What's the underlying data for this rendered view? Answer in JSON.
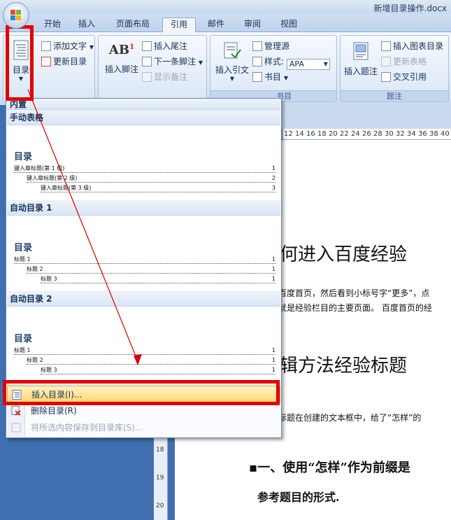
{
  "window": {
    "title": "新增目录操作.docx"
  },
  "tabs": [
    "开始",
    "插入",
    "页面布局",
    "引用",
    "邮件",
    "审阅",
    "视图"
  ],
  "active_tab": "引用",
  "ribbon": {
    "toc_group": {
      "big_button": "目录",
      "add_text": "添加文字",
      "update_toc": "更新目录"
    },
    "footnote_group": {
      "big_button": "插入脚注",
      "insert_endnote": "插入尾注",
      "next_footnote": "下一条脚注",
      "show_notes": "显示备注"
    },
    "citation_group": {
      "big_button": "插入引文",
      "manage_sources": "管理源",
      "style_label": "样式:",
      "style_value": "APA",
      "bibliography": "书目",
      "group_label_partial": "书目"
    },
    "caption_group": {
      "big_button": "插入题注",
      "insert_table_of_figures": "插入图表目录",
      "update_table": "更新表格",
      "cross_reference": "交叉引用",
      "group_label": "题注"
    }
  },
  "dropdown": {
    "header_partial": "内置",
    "sections": [
      {
        "title": "手动表格",
        "toc_heading": "目录",
        "lines": [
          {
            "text": "键入章标题(第 1 级)",
            "page": "1"
          },
          {
            "text": "键入章标题(第 2 级)",
            "page": "2"
          },
          {
            "text": "键入章标题(第 3 级)",
            "page": "3"
          }
        ]
      },
      {
        "title": "自动目录 1",
        "toc_heading": "目录",
        "lines": [
          {
            "text": "标题 1",
            "page": "1"
          },
          {
            "text": "标题 2",
            "page": "1"
          },
          {
            "text": "标题 3",
            "page": "1"
          }
        ]
      },
      {
        "title": "自动目录 2",
        "toc_heading": "目录",
        "lines": [
          {
            "text": "标题 1",
            "page": "1"
          },
          {
            "text": "标题 2",
            "page": "1"
          },
          {
            "text": "标题 3",
            "page": "1"
          }
        ]
      }
    ],
    "menu": {
      "insert_toc": "插入目录(I)...",
      "delete_toc": "删除目录(R)",
      "save_selection": "将所选内容保存到目录库(S)..."
    }
  },
  "document": {
    "ruler_numbers": [
      "12",
      "14",
      "16",
      "18",
      "20",
      "22",
      "24",
      "26",
      "28",
      "30",
      "32",
      "34",
      "36",
      "38",
      "40"
    ],
    "left_ruler_numbers": [
      "18",
      "19",
      "20"
    ],
    "heading1": "何进入百度经验",
    "para1_line1": "百度首页，然后看到小标号字“更多”，点",
    "para1_line2": "就是经验栏目的主要页面。 百度首页的经",
    "heading2": "辑方法经验标题",
    "para2": "标题在创建的文本框中，给了“怎样”的",
    "heading3_line1": "一、使用“怎样”作为前缀是",
    "heading3_line2": "参考题目的形式."
  },
  "colors": {
    "annotation_red": "#e00000",
    "highlight": "#ffd773",
    "ribbon": "#dde8f6"
  }
}
